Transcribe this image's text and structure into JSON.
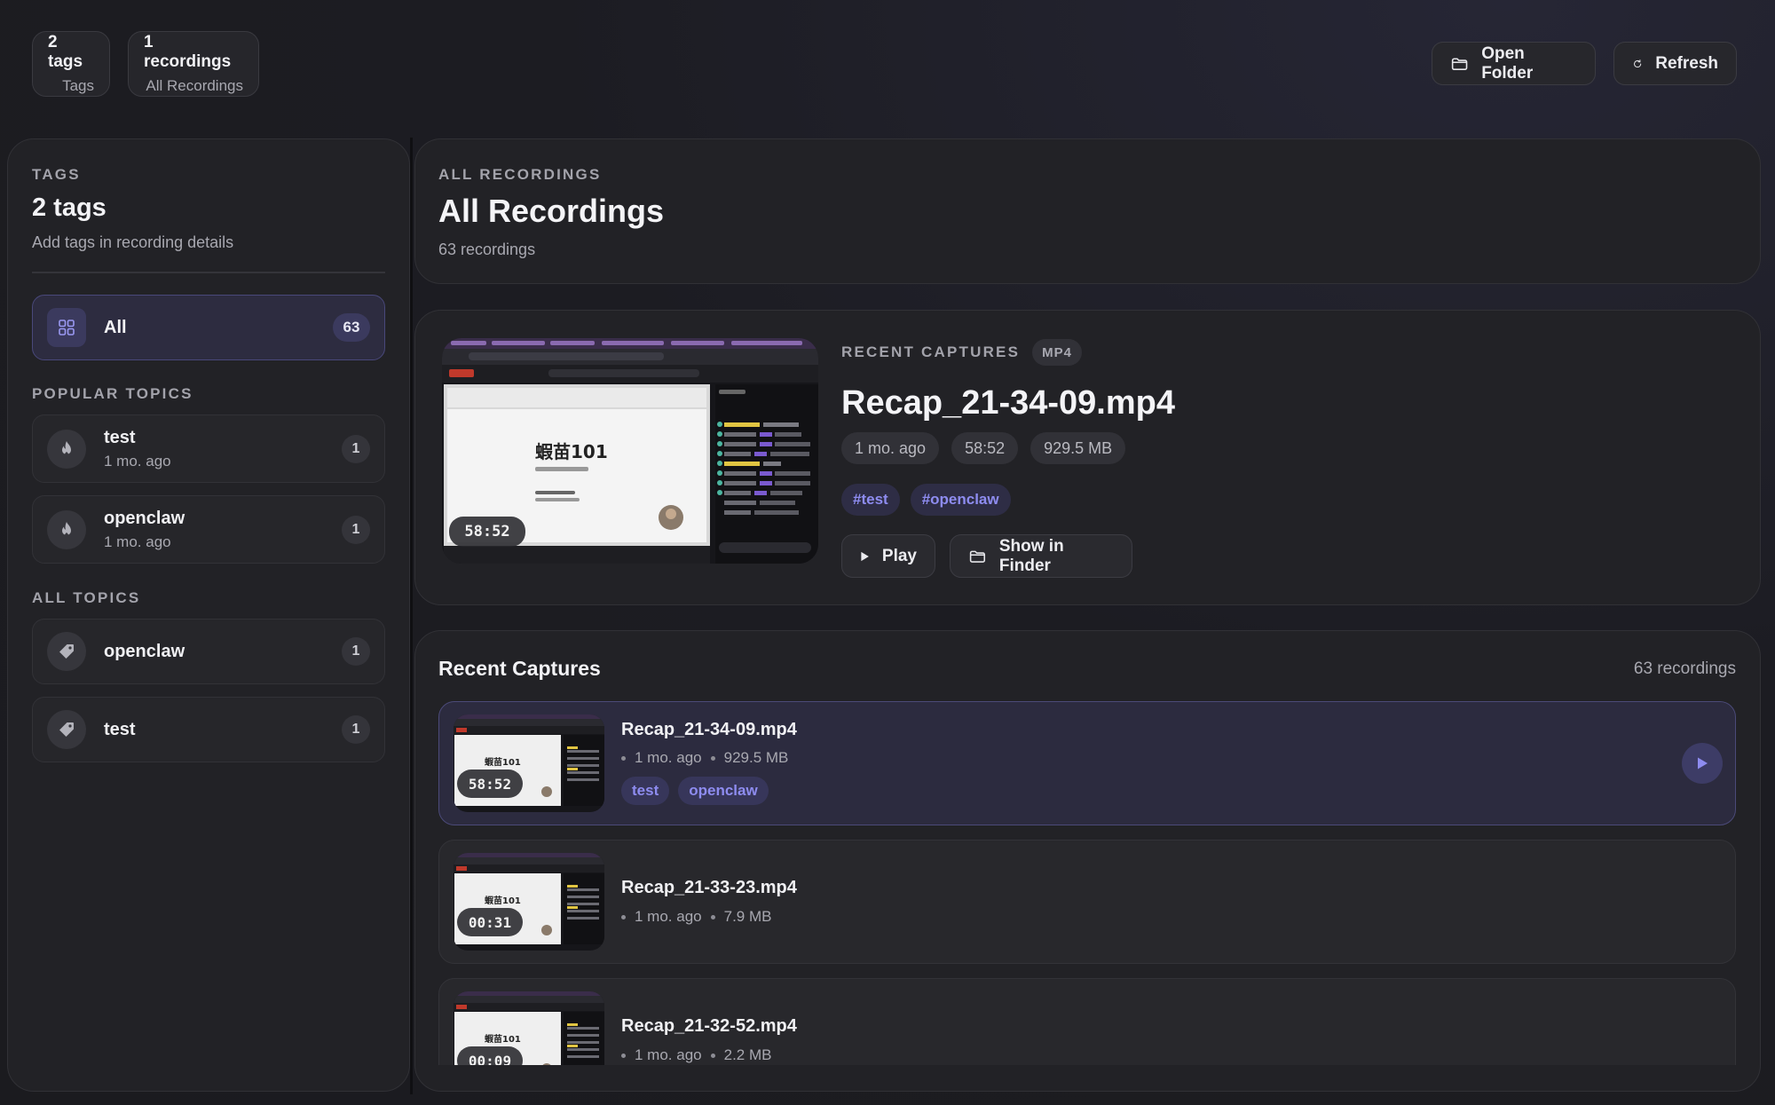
{
  "topbar": {
    "stats": [
      {
        "value": "2 tags",
        "label": "Tags"
      },
      {
        "value": "1 recordings",
        "label": "All Recordings"
      }
    ],
    "open_folder_label": "Open Folder",
    "refresh_label": "Refresh"
  },
  "sidebar": {
    "kicker": "TAGS",
    "title": "2 tags",
    "subtitle": "Add tags in recording details",
    "all_item": {
      "label": "All",
      "count": "63"
    },
    "popular_heading": "POPULAR TOPICS",
    "popular": [
      {
        "name": "test",
        "time": "1 mo. ago",
        "count": "1",
        "icon": "flame-icon"
      },
      {
        "name": "openclaw",
        "time": "1 mo. ago",
        "count": "1",
        "icon": "flame-icon"
      }
    ],
    "all_heading": "ALL TOPICS",
    "all_topics": [
      {
        "name": "openclaw",
        "count": "1",
        "icon": "tag-icon"
      },
      {
        "name": "test",
        "count": "1",
        "icon": "tag-icon"
      }
    ]
  },
  "header": {
    "kicker": "ALL RECORDINGS",
    "title": "All Recordings",
    "subtitle": "63 recordings"
  },
  "featured": {
    "kicker": "RECENT CAPTURES",
    "format": "MP4",
    "title": "Recap_21-34-09.mp4",
    "chips": [
      "1 mo. ago",
      "58:52",
      "929.5 MB"
    ],
    "tags": [
      "#test",
      "#openclaw"
    ],
    "duration": "58:52",
    "thumb_heading": "蝦苗101",
    "play_label": "Play",
    "finder_label": "Show in Finder"
  },
  "list": {
    "title": "Recent Captures",
    "count": "63 recordings",
    "items": [
      {
        "name": "Recap_21-34-09.mp4",
        "time": "1 mo. ago",
        "size": "929.5 MB",
        "duration": "58:52",
        "tags": [
          "test",
          "openclaw"
        ],
        "thumb_heading": "蝦苗101"
      },
      {
        "name": "Recap_21-33-23.mp4",
        "time": "1 mo. ago",
        "size": "7.9 MB",
        "duration": "00:31",
        "thumb_heading": "蝦苗101"
      },
      {
        "name": "Recap_21-32-52.mp4",
        "time": "1 mo. ago",
        "size": "2.2 MB",
        "duration": "00:09",
        "thumb_heading": "蝦苗101"
      }
    ]
  },
  "colors": {
    "accent": "#8e8cf0",
    "selected_bg": "#2c2b3f",
    "panel_bg": "#222226",
    "page_bg": "#1c1c22"
  }
}
